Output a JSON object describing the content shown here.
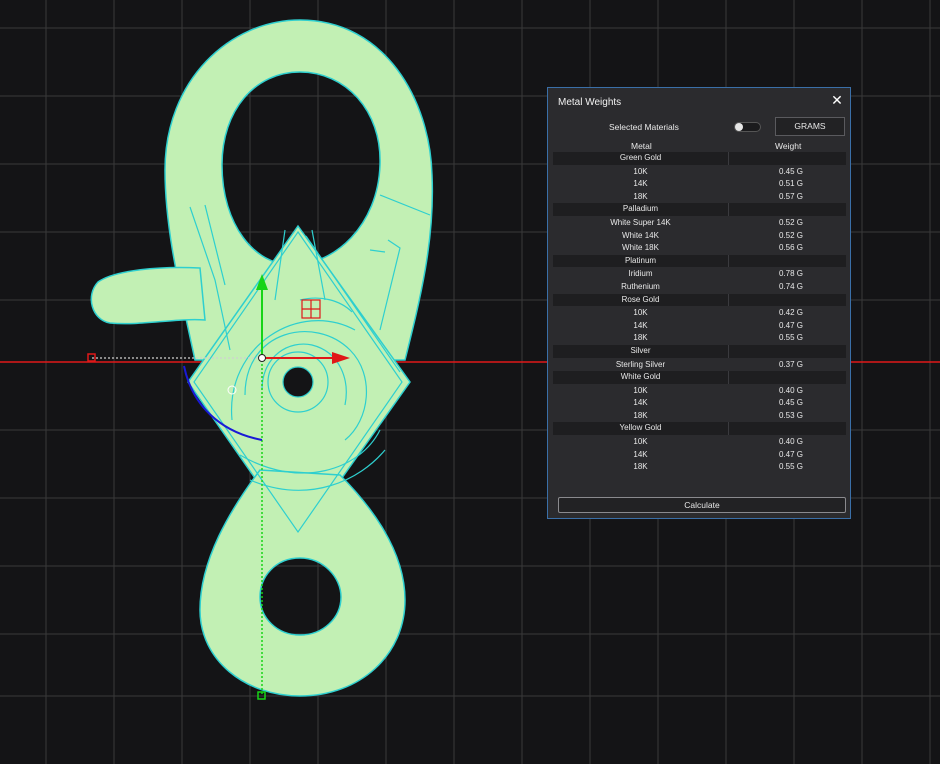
{
  "panel": {
    "title": "Metal Weights",
    "close_icon": "close-icon",
    "selected_materials_label": "Selected Materials",
    "selected_materials_on": false,
    "units_button": "GRAMS",
    "columns": {
      "metal": "Metal",
      "weight": "Weight"
    },
    "groups": [
      {
        "name": "Green Gold",
        "items": [
          {
            "metal": "10K",
            "weight": "0.45 G"
          },
          {
            "metal": "14K",
            "weight": "0.51 G"
          },
          {
            "metal": "18K",
            "weight": "0.57 G"
          }
        ]
      },
      {
        "name": "Palladium",
        "items": [
          {
            "metal": "White Super 14K",
            "weight": "0.52 G"
          },
          {
            "metal": "White 14K",
            "weight": "0.52 G"
          },
          {
            "metal": "White 18K",
            "weight": "0.56 G"
          }
        ]
      },
      {
        "name": "Platinum",
        "items": [
          {
            "metal": "Iridium",
            "weight": "0.78 G"
          },
          {
            "metal": "Ruthenium",
            "weight": "0.74 G"
          }
        ]
      },
      {
        "name": "Rose Gold",
        "items": [
          {
            "metal": "10K",
            "weight": "0.42 G"
          },
          {
            "metal": "14K",
            "weight": "0.47 G"
          },
          {
            "metal": "18K",
            "weight": "0.55 G"
          }
        ]
      },
      {
        "name": "Silver",
        "items": [
          {
            "metal": "Sterling Silver",
            "weight": "0.37 G"
          }
        ]
      },
      {
        "name": "White Gold",
        "items": [
          {
            "metal": "10K",
            "weight": "0.40 G"
          },
          {
            "metal": "14K",
            "weight": "0.45 G"
          },
          {
            "metal": "18K",
            "weight": "0.53 G"
          }
        ]
      },
      {
        "name": "Yellow Gold",
        "items": [
          {
            "metal": "10K",
            "weight": "0.40 G"
          },
          {
            "metal": "14K",
            "weight": "0.47 G"
          },
          {
            "metal": "18K",
            "weight": "0.55 G"
          }
        ]
      }
    ],
    "calculate_button": "Calculate"
  },
  "viewport": {
    "background": "#141416",
    "grid_color": "#3a3a3a",
    "x_axis_color": "#e01818",
    "y_axis_color": "#17d417",
    "model_fill": "#c2f0b4",
    "model_edge": "#2ecfcf",
    "rotation_arc_color": "#1a1ad6",
    "gumball_icons": [
      "move-x-arrow-icon",
      "move-y-arrow-icon",
      "plane-handle-icon",
      "rotate-arc-icon"
    ]
  }
}
